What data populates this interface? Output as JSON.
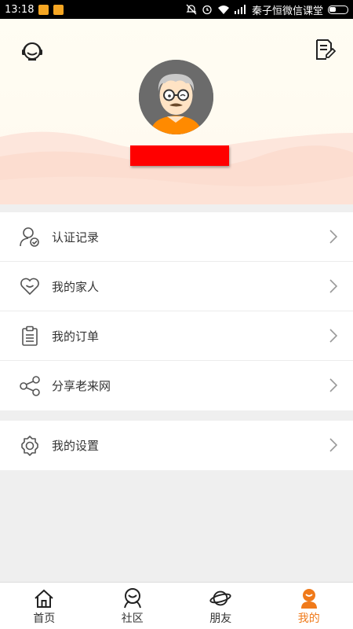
{
  "status_bar": {
    "time": "13:18",
    "carrier": "秦子恒微信课堂",
    "icons": [
      "app-notification-icon",
      "app-notification-icon",
      "mute-icon",
      "alarm-icon",
      "wifi-icon",
      "signal-icon",
      "battery-icon"
    ]
  },
  "header": {
    "left_icon": "customer-service-icon",
    "right_icon": "edit-document-icon",
    "avatar_icon": "user-avatar"
  },
  "menu_group_1": [
    {
      "label": "认证记录",
      "icon": "verified-user-icon"
    },
    {
      "label": "我的家人",
      "icon": "heart-smile-icon"
    },
    {
      "label": "我的订单",
      "icon": "clipboard-icon"
    },
    {
      "label": "分享老来网",
      "icon": "share-icon"
    }
  ],
  "menu_group_2": [
    {
      "label": "我的设置",
      "icon": "settings-icon"
    }
  ],
  "tabs": [
    {
      "label": "首页",
      "icon": "home-icon",
      "active": false
    },
    {
      "label": "社区",
      "icon": "community-icon",
      "active": false
    },
    {
      "label": "朋友",
      "icon": "planet-icon",
      "active": false
    },
    {
      "label": "我的",
      "icon": "profile-icon",
      "active": true
    }
  ],
  "colors": {
    "accent": "#f07a1a",
    "name_redacted": "#ff0000",
    "header_bg": "#fffdf3",
    "page_bg": "#efefef"
  }
}
